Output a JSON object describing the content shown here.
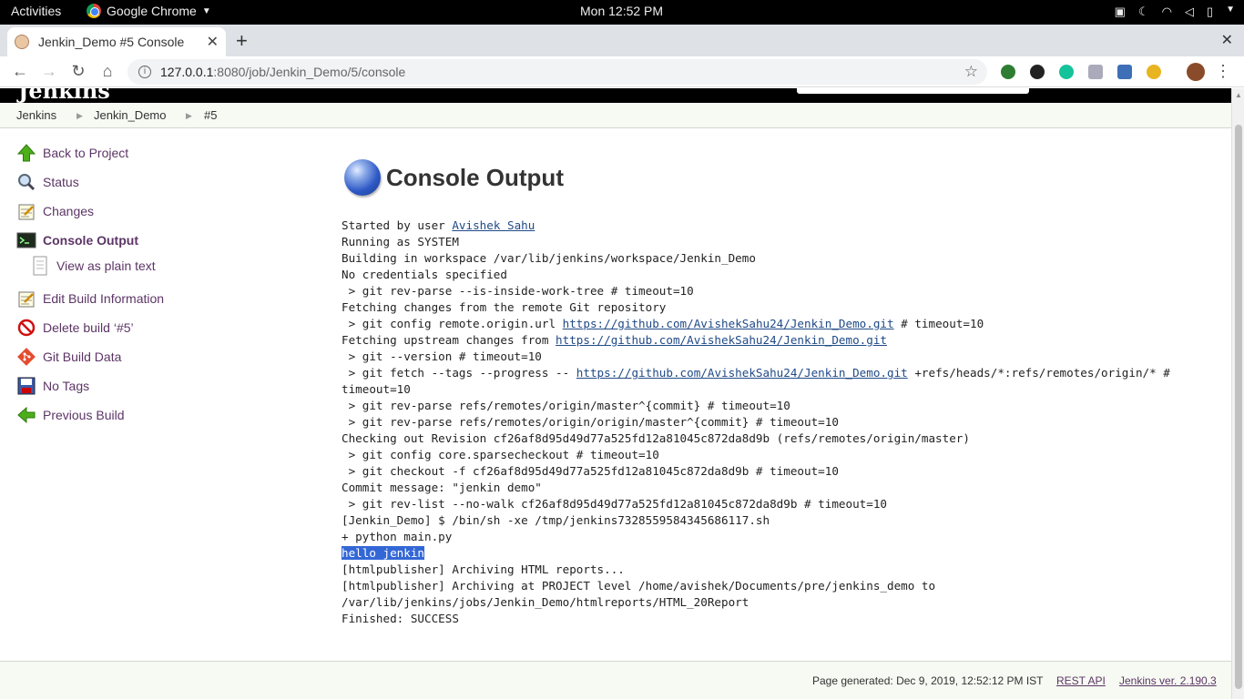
{
  "system_bar": {
    "activities": "Activities",
    "app_name": "Google Chrome",
    "clock": "Mon 12:52 PM"
  },
  "browser": {
    "tab_title": "Jenkin_Demo #5 Console",
    "url_host": "127.0.0.1",
    "url_path": ":8080/job/Jenkin_Demo/5/console"
  },
  "breadcrumbs": [
    "Jenkins",
    "Jenkin_Demo",
    "#5"
  ],
  "sidebar": {
    "items": [
      {
        "label": "Back to Project",
        "icon": "up-arrow-icon"
      },
      {
        "label": "Status",
        "icon": "magnifier-icon"
      },
      {
        "label": "Changes",
        "icon": "notepad-icon"
      },
      {
        "label": "Console Output",
        "icon": "terminal-icon"
      },
      {
        "label": "View as plain text",
        "icon": "document-icon"
      },
      {
        "label": "Edit Build Information",
        "icon": "notepad-icon"
      },
      {
        "label": "Delete build ‘#5’",
        "icon": "no-entry-icon"
      },
      {
        "label": "Git Build Data",
        "icon": "git-icon"
      },
      {
        "label": "No Tags",
        "icon": "floppy-disk-icon"
      },
      {
        "label": "Previous Build",
        "icon": "left-arrow-icon"
      }
    ]
  },
  "main": {
    "title": "Console Output",
    "console": {
      "started_by": "Started by user ",
      "user_link": "Avishek Sahu",
      "running_as": "Running as SYSTEM",
      "building_in": "Building in workspace /var/lib/jenkins/workspace/Jenkin_Demo",
      "no_credentials": "No credentials specified",
      "rev_parse_tree": " > git rev-parse --is-inside-work-tree # timeout=10",
      "fetching_changes": "Fetching changes from the remote Git repository",
      "config_prefix": " > git config remote.origin.url ",
      "repo_url": "https://github.com/AvishekSahu24/Jenkin_Demo.git",
      "config_suffix": " # timeout=10",
      "fetching_upstream": "Fetching upstream changes from ",
      "git_version": " > git --version # timeout=10",
      "fetch_prefix": " > git fetch --tags --progress -- ",
      "fetch_suffix": " +refs/heads/*:refs/remotes/origin/* #",
      "fetch_timeout": "timeout=10",
      "rev_parse_master": " > git rev-parse refs/remotes/origin/master^{commit} # timeout=10",
      "rev_parse_origin_master": " > git rev-parse refs/remotes/origin/origin/master^{commit} # timeout=10",
      "checking_out": "Checking out Revision cf26af8d95d49d77a525fd12a81045c872da8d9b (refs/remotes/origin/master)",
      "sparse": " > git config core.sparsecheckout # timeout=10",
      "checkout": " > git checkout -f cf26af8d95d49d77a525fd12a81045c872da8d9b # timeout=10",
      "commit_message": "Commit message: \"jenkin demo\"",
      "rev_list": " > git rev-list --no-walk cf26af8d95d49d77a525fd12a81045c872da8d9b # timeout=10",
      "shell": "[Jenkin_Demo] $ /bin/sh -xe /tmp/jenkins7328559584345686117.sh",
      "python": "+ python main.py",
      "hello": "hello jenkin",
      "archiving_html": "[htmlpublisher] Archiving HTML reports...",
      "archiving_at": "[htmlpublisher] Archiving at PROJECT level /home/avishek/Documents/pre/jenkins_demo to",
      "archive_dest": "/var/lib/jenkins/jobs/Jenkin_Demo/htmlreports/HTML_20Report",
      "finished": "Finished: SUCCESS"
    }
  },
  "footer": {
    "generated": "Page generated: Dec 9, 2019, 12:52:12 PM IST",
    "rest_api": "REST API",
    "version": "Jenkins ver. 2.190.3"
  }
}
